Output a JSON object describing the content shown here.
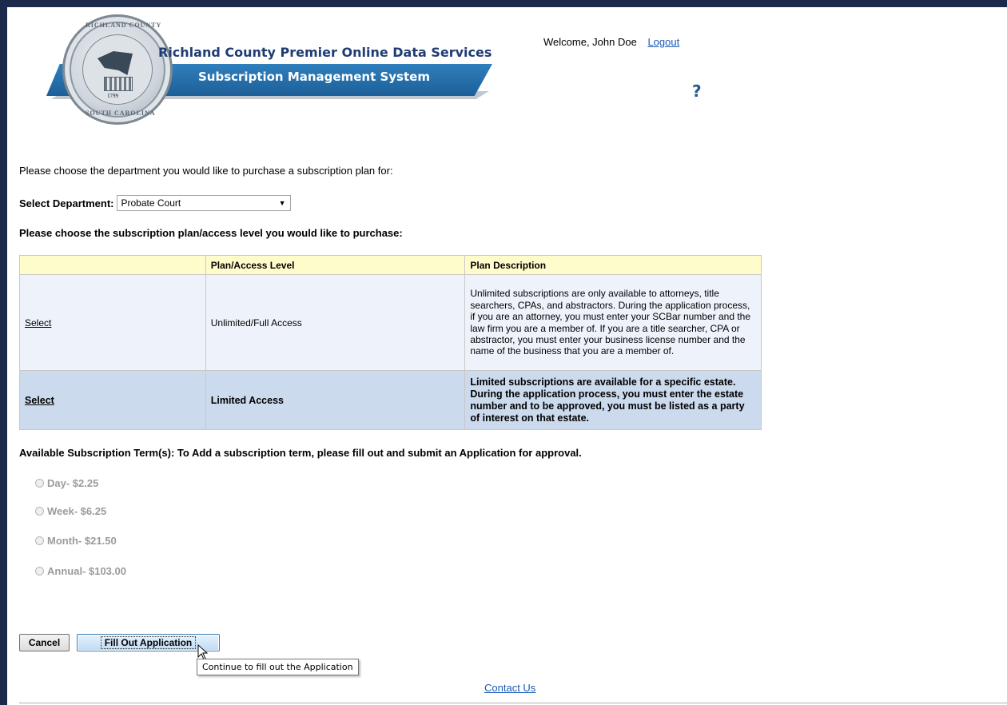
{
  "header": {
    "title_line1": "Richland County Premier Online Data Services",
    "title_line2": "Subscription Management System",
    "welcome_text": "Welcome, John Doe",
    "logout_label": "Logout",
    "help_icon": "question-mark-icon",
    "seal_text_top": "RICHLAND COUNTY",
    "seal_text_bottom": "SOUTH CAROLINA",
    "seal_year": "1799"
  },
  "intro_text": "Please choose the department you would like to purchase a subscription plan for:",
  "department": {
    "label": "Select Department:",
    "selected": "Probate Court"
  },
  "plan_heading": "Please choose the subscription plan/access level you would like to purchase:",
  "plan_table": {
    "headers": [
      "",
      "Plan/Access Level",
      "Plan Description"
    ],
    "rows": [
      {
        "action": "Select",
        "level": "Unlimited/Full Access",
        "description": "Unlimited subscriptions are only available to attorneys, title searchers, CPAs, and abstractors. During the application process, if you are an attorney, you must enter your SCBar number and the law firm you are a member of. If you are a title searcher, CPA or abstractor, you must enter your business license number and the name of the business that you are a member of."
      },
      {
        "action": "Select",
        "level": "Limited Access",
        "description": "Limited subscriptions are available for a specific estate. During the application process, you must enter the estate number and to be approved, you must be listed as a party of interest on that estate."
      }
    ]
  },
  "terms": {
    "heading": "Available Subscription Term(s): To Add a subscription term, please fill out and submit an Application for approval.",
    "options": [
      "Day- $2.25",
      "Week- $6.25",
      "Month- $21.50",
      "Annual- $103.00"
    ]
  },
  "buttons": {
    "cancel": "Cancel",
    "fill_out": "Fill Out Application"
  },
  "tooltip": "Continue to fill out the Application",
  "footer": {
    "contact": "Contact Us"
  },
  "colors": {
    "frame": "#1b2a4a",
    "banner": "#2f7fbd",
    "link": "#1a5bb5",
    "header_row": "#fffccc",
    "row1": "#eef3fb",
    "row2": "#ccdaee"
  }
}
